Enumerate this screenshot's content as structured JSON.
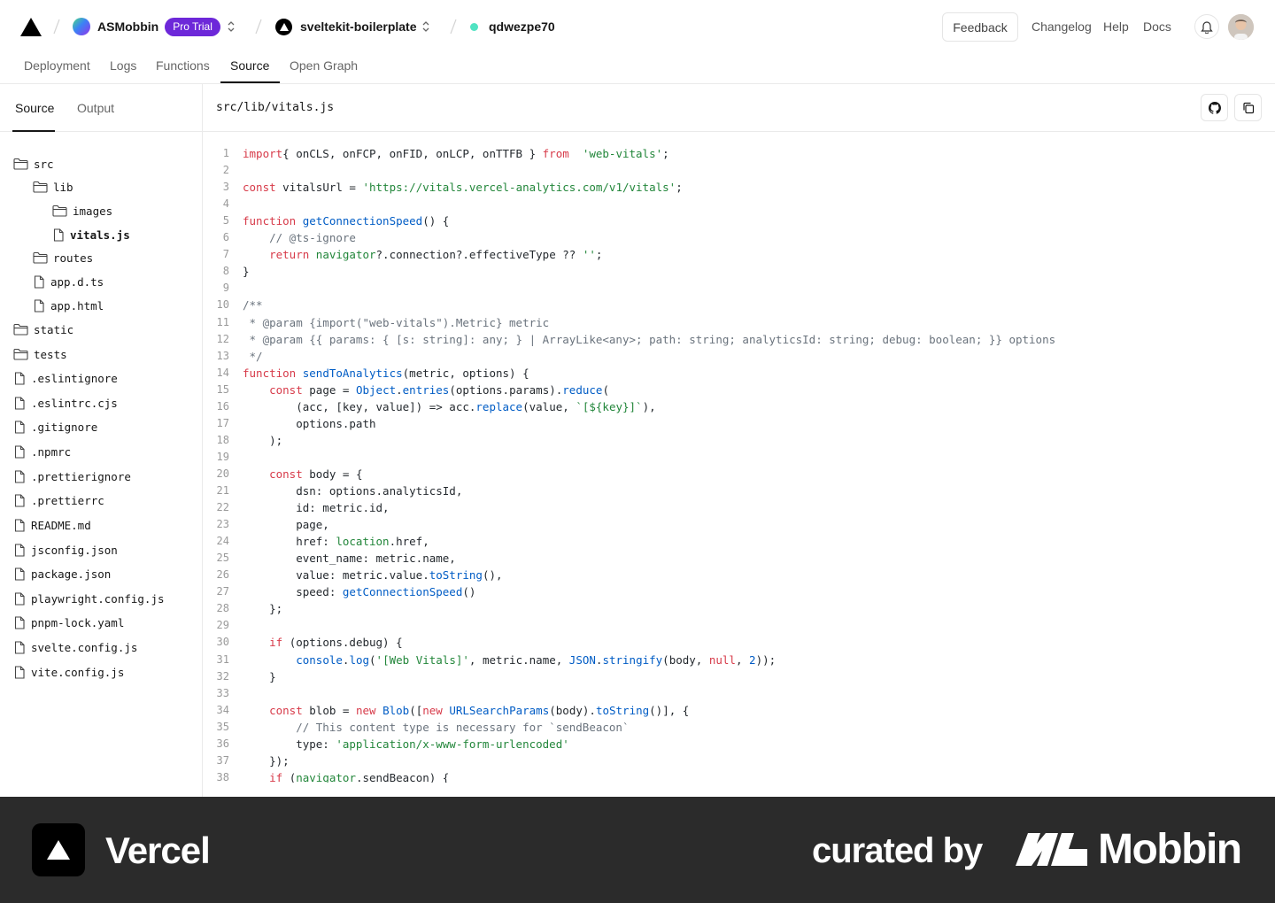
{
  "header": {
    "team_name": "ASMobbin",
    "team_badge": "Pro Trial",
    "project_name": "sveltekit-boilerplate",
    "deployment_id": "qdwezpe70",
    "feedback_label": "Feedback",
    "links": [
      "Changelog",
      "Help",
      "Docs"
    ]
  },
  "tabs": [
    "Deployment",
    "Logs",
    "Functions",
    "Source",
    "Open Graph"
  ],
  "active_tab": "Source",
  "sidebar": {
    "tabs": [
      "Source",
      "Output"
    ],
    "active_tab": "Source",
    "tree": [
      {
        "name": "src",
        "type": "folder",
        "depth": 0
      },
      {
        "name": "lib",
        "type": "folder",
        "depth": 1
      },
      {
        "name": "images",
        "type": "folder",
        "depth": 2
      },
      {
        "name": "vitals.js",
        "type": "file",
        "depth": 2,
        "selected": true
      },
      {
        "name": "routes",
        "type": "folder",
        "depth": 1
      },
      {
        "name": "app.d.ts",
        "type": "file",
        "depth": 1
      },
      {
        "name": "app.html",
        "type": "file",
        "depth": 1
      },
      {
        "name": "static",
        "type": "folder",
        "depth": 0
      },
      {
        "name": "tests",
        "type": "folder",
        "depth": 0
      },
      {
        "name": ".eslintignore",
        "type": "file",
        "depth": 0
      },
      {
        "name": ".eslintrc.cjs",
        "type": "file",
        "depth": 0
      },
      {
        "name": ".gitignore",
        "type": "file",
        "depth": 0
      },
      {
        "name": ".npmrc",
        "type": "file",
        "depth": 0
      },
      {
        "name": ".prettierignore",
        "type": "file",
        "depth": 0
      },
      {
        "name": ".prettierrc",
        "type": "file",
        "depth": 0
      },
      {
        "name": "README.md",
        "type": "file",
        "depth": 0
      },
      {
        "name": "jsconfig.json",
        "type": "file",
        "depth": 0
      },
      {
        "name": "package.json",
        "type": "file",
        "depth": 0
      },
      {
        "name": "playwright.config.js",
        "type": "file",
        "depth": 0
      },
      {
        "name": "pnpm-lock.yaml",
        "type": "file",
        "depth": 0
      },
      {
        "name": "svelte.config.js",
        "type": "file",
        "depth": 0
      },
      {
        "name": "vite.config.js",
        "type": "file",
        "depth": 0
      }
    ]
  },
  "file": {
    "path": "src/lib/vitals.js",
    "lines": [
      [
        [
          "kw",
          "import"
        ],
        [
          "",
          "{ onCLS, onFCP, onFID, onLCP, onTTFB } "
        ],
        [
          "kw",
          "from"
        ],
        [
          "",
          "  "
        ],
        [
          "str",
          "'web-vitals'"
        ],
        [
          "",
          ";"
        ]
      ],
      [],
      [
        [
          "kw",
          "const"
        ],
        [
          "",
          " vitalsUrl = "
        ],
        [
          "str",
          "'https://vitals.vercel-analytics.com/v1/vitals'"
        ],
        [
          "",
          ";"
        ]
      ],
      [],
      [
        [
          "kw",
          "function"
        ],
        [
          "",
          ""
        ],
        [
          "fn",
          " getConnectionSpeed"
        ],
        [
          "",
          "() {"
        ]
      ],
      [
        [
          "cm",
          "    // @ts-ignore"
        ]
      ],
      [
        [
          "",
          "    "
        ],
        [
          "kw",
          "return"
        ],
        [
          "",
          ""
        ],
        [
          "gl",
          " navigator"
        ],
        [
          "",
          "?.connection?.effectiveType ?? "
        ],
        [
          "str",
          "''"
        ],
        [
          "",
          ";"
        ]
      ],
      [
        [
          "",
          "}"
        ]
      ],
      [],
      [
        [
          "cm",
          "/**"
        ]
      ],
      [
        [
          "cm",
          " * @param {import(\"web-vitals\").Metric} metric"
        ]
      ],
      [
        [
          "cm",
          " * @param {{ params: { [s: string]: any; } | ArrayLike<any>; path: string; analyticsId: string; debug: boolean; }} options"
        ]
      ],
      [
        [
          "cm",
          " */"
        ]
      ],
      [
        [
          "kw",
          "function"
        ],
        [
          "fn",
          " sendToAnalytics"
        ],
        [
          "",
          "(metric, options) {"
        ]
      ],
      [
        [
          "",
          "    "
        ],
        [
          "kw",
          "const"
        ],
        [
          "",
          " page = "
        ],
        [
          "fn",
          "Object"
        ],
        [
          "",
          "."
        ],
        [
          "fn",
          "entries"
        ],
        [
          "",
          "(options.params)."
        ],
        [
          "fn",
          "reduce"
        ],
        [
          "",
          "("
        ]
      ],
      [
        [
          "",
          "        (acc, [key, value]) => acc."
        ],
        [
          "fn",
          "replace"
        ],
        [
          "",
          "(value, "
        ],
        [
          "str",
          "`[${key}]`"
        ],
        [
          "",
          "),"
        ]
      ],
      [
        [
          "",
          "        options.path"
        ]
      ],
      [
        [
          "",
          "    );"
        ]
      ],
      [],
      [
        [
          "",
          "    "
        ],
        [
          "kw",
          "const"
        ],
        [
          "",
          " body = {"
        ]
      ],
      [
        [
          "",
          "        dsn: options.analyticsId,"
        ]
      ],
      [
        [
          "",
          "        id: metric.id,"
        ]
      ],
      [
        [
          "",
          "        page,"
        ]
      ],
      [
        [
          "",
          "        href: "
        ],
        [
          "gl",
          "location"
        ],
        [
          "",
          ".href,"
        ]
      ],
      [
        [
          "",
          "        event_name: metric.name,"
        ]
      ],
      [
        [
          "",
          "        value: metric.value."
        ],
        [
          "fn",
          "toString"
        ],
        [
          "",
          "(),"
        ]
      ],
      [
        [
          "",
          "        speed: "
        ],
        [
          "fn",
          "getConnectionSpeed"
        ],
        [
          "",
          "()"
        ]
      ],
      [
        [
          "",
          "    };"
        ]
      ],
      [],
      [
        [
          "",
          "    "
        ],
        [
          "kw",
          "if"
        ],
        [
          "",
          " (options.debug) {"
        ]
      ],
      [
        [
          "",
          "        "
        ],
        [
          "fn",
          "console"
        ],
        [
          "",
          "."
        ],
        [
          "fn",
          "log"
        ],
        [
          "",
          "("
        ],
        [
          "str",
          "'[Web Vitals]'"
        ],
        [
          "",
          ", metric.name, "
        ],
        [
          "fn",
          "JSON"
        ],
        [
          "",
          "."
        ],
        [
          "fn",
          "stringify"
        ],
        [
          "",
          "(body, "
        ],
        [
          "kw",
          "null"
        ],
        [
          "",
          ", "
        ],
        [
          "fn",
          "2"
        ],
        [
          "",
          "));"
        ]
      ],
      [
        [
          "",
          "    }"
        ]
      ],
      [],
      [
        [
          "",
          "    "
        ],
        [
          "kw",
          "const"
        ],
        [
          "",
          " blob = "
        ],
        [
          "kw",
          "new"
        ],
        [
          "fn",
          " Blob"
        ],
        [
          "",
          "(["
        ],
        [
          "kw",
          "new"
        ],
        [
          "fn",
          " URLSearchParams"
        ],
        [
          "",
          "(body)."
        ],
        [
          "fn",
          "toString"
        ],
        [
          "",
          "()], {"
        ]
      ],
      [
        [
          "cm",
          "        // This content type is necessary for `sendBeacon`"
        ]
      ],
      [
        [
          "",
          "        type: "
        ],
        [
          "str",
          "'application/x-www-form-urlencoded'"
        ]
      ],
      [
        [
          "",
          "    });"
        ]
      ],
      [
        [
          "",
          "    "
        ],
        [
          "kw",
          "if"
        ],
        [
          "",
          " ("
        ],
        [
          "gl",
          "navigator"
        ],
        [
          "",
          ".sendBeacon) {"
        ]
      ]
    ]
  },
  "footer": {
    "brand": "Vercel",
    "curated_by": "curated by",
    "curator": "Mobbin"
  },
  "colors": {
    "badge": "#6d28d9",
    "status_dot": "#50e3c2",
    "keyword": "#d73a49",
    "function": "#005cc5",
    "string": "#22863a",
    "comment": "#6a737d",
    "footer_bg": "#2b2b2b"
  }
}
